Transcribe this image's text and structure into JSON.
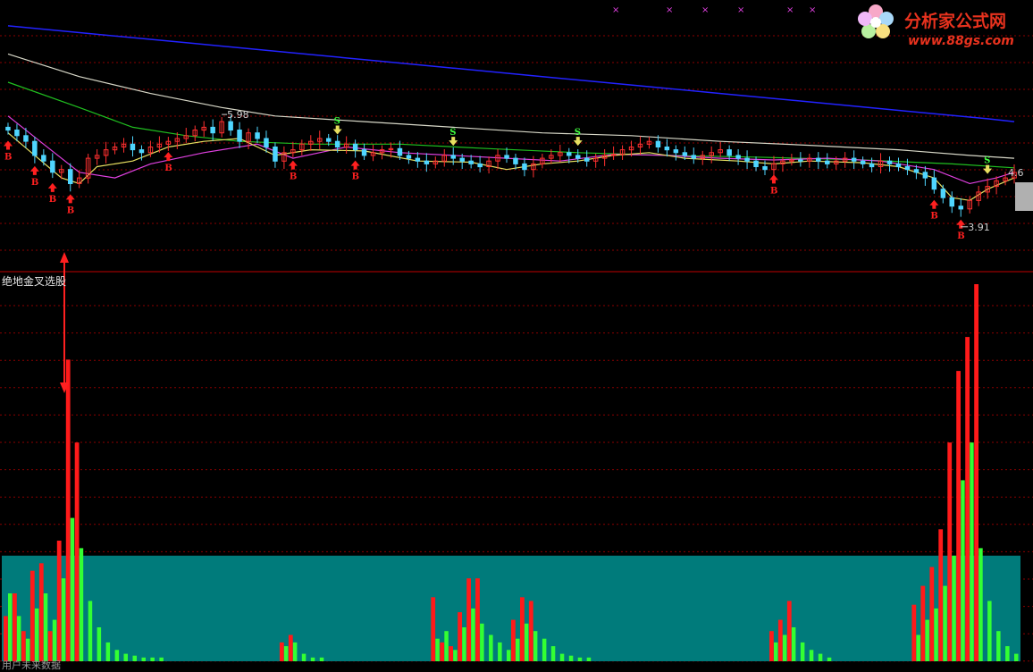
{
  "logo": {
    "name": "分析家公式网",
    "url": "www.88gs.com",
    "colors": {
      "name": "#e8321e",
      "url": "#e8321e"
    }
  },
  "colors": {
    "background": "#000000",
    "divider": "#c00000",
    "grid": "#8b0000",
    "up_candle": "#ff3030",
    "down_candle": "#4fd6ff",
    "bar_red": "#ff1a1a",
    "bar_green": "#33ff33",
    "teal_area": "#007b7b",
    "ma_blue": "#2222ff",
    "ma_white": "#d8d8c8",
    "ma_green": "#20c020",
    "ma_magenta": "#e040e0",
    "ma_yellow": "#e8e060",
    "signal_b": "#ff2020",
    "signal_s": "#40ff40"
  },
  "indicator": {
    "title": "绝地金叉选股",
    "bottom_label": "用户未来数据"
  },
  "chart_data": [
    {
      "type": "line",
      "name": "price-panel",
      "annotations": {
        "high": "5.98",
        "low": "3.91",
        "last": "4.6"
      },
      "x_count": 114,
      "series": [
        {
          "color": "#2222ff",
          "values": [
            [
              0,
              7.9
            ],
            [
              10,
              7.75
            ],
            [
              20,
              7.6
            ],
            [
              30,
              7.45
            ],
            [
              40,
              7.3
            ],
            [
              50,
              7.15
            ],
            [
              60,
              7.0
            ],
            [
              70,
              6.85
            ],
            [
              80,
              6.7
            ],
            [
              90,
              6.55
            ],
            [
              100,
              6.4
            ],
            [
              110,
              6.25
            ],
            [
              113,
              6.2
            ]
          ]
        },
        {
          "color": "#d8d8c8",
          "values": [
            [
              0,
              7.4
            ],
            [
              8,
              7.0
            ],
            [
              16,
              6.7
            ],
            [
              24,
              6.45
            ],
            [
              30,
              6.3
            ],
            [
              40,
              6.2
            ],
            [
              50,
              6.1
            ],
            [
              60,
              6.0
            ],
            [
              70,
              5.95
            ],
            [
              80,
              5.85
            ],
            [
              90,
              5.78
            ],
            [
              100,
              5.7
            ],
            [
              108,
              5.6
            ],
            [
              113,
              5.55
            ]
          ]
        },
        {
          "color": "#20c020",
          "values": [
            [
              0,
              6.9
            ],
            [
              8,
              6.45
            ],
            [
              14,
              6.1
            ],
            [
              20,
              5.95
            ],
            [
              26,
              5.85
            ],
            [
              34,
              5.8
            ],
            [
              44,
              5.8
            ],
            [
              54,
              5.72
            ],
            [
              64,
              5.65
            ],
            [
              74,
              5.6
            ],
            [
              84,
              5.57
            ],
            [
              96,
              5.52
            ],
            [
              106,
              5.45
            ],
            [
              113,
              5.38
            ]
          ]
        },
        {
          "color": "#e040e0",
          "values": [
            [
              0,
              6.3
            ],
            [
              4,
              5.8
            ],
            [
              8,
              5.3
            ],
            [
              12,
              5.2
            ],
            [
              16,
              5.45
            ],
            [
              22,
              5.65
            ],
            [
              28,
              5.8
            ],
            [
              32,
              5.55
            ],
            [
              38,
              5.75
            ],
            [
              44,
              5.65
            ],
            [
              50,
              5.6
            ],
            [
              56,
              5.55
            ],
            [
              62,
              5.5
            ],
            [
              68,
              5.62
            ],
            [
              74,
              5.6
            ],
            [
              80,
              5.55
            ],
            [
              86,
              5.52
            ],
            [
              92,
              5.55
            ],
            [
              98,
              5.5
            ],
            [
              104,
              5.35
            ],
            [
              108,
              5.1
            ],
            [
              111,
              5.2
            ],
            [
              113,
              5.3
            ]
          ]
        },
        {
          "color": "#e8e060",
          "values": [
            [
              0,
              6.0
            ],
            [
              3,
              5.6
            ],
            [
              6,
              5.2
            ],
            [
              8,
              5.1
            ],
            [
              10,
              5.4
            ],
            [
              14,
              5.5
            ],
            [
              18,
              5.75
            ],
            [
              22,
              5.85
            ],
            [
              26,
              5.9
            ],
            [
              30,
              5.6
            ],
            [
              34,
              5.7
            ],
            [
              40,
              5.68
            ],
            [
              46,
              5.5
            ],
            [
              52,
              5.48
            ],
            [
              56,
              5.35
            ],
            [
              60,
              5.45
            ],
            [
              64,
              5.5
            ],
            [
              68,
              5.6
            ],
            [
              72,
              5.65
            ],
            [
              76,
              5.55
            ],
            [
              82,
              5.5
            ],
            [
              86,
              5.45
            ],
            [
              90,
              5.5
            ],
            [
              96,
              5.47
            ],
            [
              100,
              5.4
            ],
            [
              104,
              5.2
            ],
            [
              106,
              4.85
            ],
            [
              108,
              4.8
            ],
            [
              110,
              5.0
            ],
            [
              113,
              5.2
            ]
          ]
        }
      ],
      "closes": [
        6.05,
        5.95,
        5.85,
        5.6,
        5.5,
        5.3,
        5.35,
        5.1,
        5.2,
        5.55,
        5.6,
        5.7,
        5.75,
        5.8,
        5.7,
        5.65,
        5.75,
        5.8,
        5.85,
        5.9,
        5.95,
        6.05,
        6.1,
        6.0,
        6.2,
        6.05,
        5.85,
        6.0,
        5.9,
        5.75,
        5.5,
        5.65,
        5.7,
        5.8,
        5.85,
        5.9,
        5.85,
        5.75,
        5.8,
        5.7,
        5.6,
        5.65,
        5.7,
        5.72,
        5.6,
        5.55,
        5.5,
        5.45,
        5.5,
        5.6,
        5.55,
        5.5,
        5.45,
        5.4,
        5.5,
        5.6,
        5.55,
        5.45,
        5.35,
        5.45,
        5.55,
        5.6,
        5.65,
        5.6,
        5.55,
        5.5,
        5.55,
        5.6,
        5.62,
        5.7,
        5.75,
        5.8,
        5.85,
        5.75,
        5.7,
        5.65,
        5.6,
        5.55,
        5.6,
        5.65,
        5.7,
        5.6,
        5.55,
        5.5,
        5.4,
        5.35,
        5.45,
        5.5,
        5.52,
        5.5,
        5.55,
        5.5,
        5.45,
        5.5,
        5.55,
        5.5,
        5.45,
        5.4,
        5.5,
        5.45,
        5.4,
        5.35,
        5.3,
        5.2,
        5.0,
        4.85,
        4.7,
        4.65,
        4.8,
        4.95,
        5.05,
        5.15,
        5.2,
        5.3
      ],
      "signals": [
        {
          "i": 0,
          "type": "B",
          "at": "below"
        },
        {
          "i": 3,
          "type": "B",
          "at": "below"
        },
        {
          "i": 5,
          "type": "B",
          "at": "below"
        },
        {
          "i": 7,
          "type": "B",
          "at": "below"
        },
        {
          "i": 18,
          "type": "B",
          "at": "below"
        },
        {
          "i": 32,
          "type": "B",
          "at": "below"
        },
        {
          "i": 37,
          "type": "S",
          "at": "above"
        },
        {
          "i": 39,
          "type": "B",
          "at": "below"
        },
        {
          "i": 50,
          "type": "S",
          "at": "above"
        },
        {
          "i": 64,
          "type": "S",
          "at": "above"
        },
        {
          "i": 86,
          "type": "B",
          "at": "below"
        },
        {
          "i": 104,
          "type": "B",
          "at": "below"
        },
        {
          "i": 107,
          "type": "B",
          "at": "below"
        },
        {
          "i": 110,
          "type": "S",
          "at": "above"
        }
      ]
    },
    {
      "type": "bar",
      "name": "indicator-panel",
      "title": "绝地金叉选股",
      "teal_level": 0.28,
      "n": 114,
      "bars": [
        {
          "i": 0,
          "r": 0.12,
          "g": 0.18
        },
        {
          "i": 1,
          "r": 0.18,
          "g": 0.12
        },
        {
          "i": 2,
          "r": 0.08,
          "g": 0.06
        },
        {
          "i": 3,
          "r": 0.24,
          "g": 0.14
        },
        {
          "i": 4,
          "r": 0.26,
          "g": 0.18
        },
        {
          "i": 5,
          "r": 0.08,
          "g": 0.11
        },
        {
          "i": 6,
          "r": 0.32,
          "g": 0.22
        },
        {
          "i": 7,
          "r": 0.8,
          "g": 0.38
        },
        {
          "i": 8,
          "r": 0.58,
          "g": 0.3
        },
        {
          "i": 9,
          "r": 0,
          "g": 0.16
        },
        {
          "i": 10,
          "r": 0,
          "g": 0.09
        },
        {
          "i": 11,
          "r": 0,
          "g": 0.05
        },
        {
          "i": 12,
          "r": 0,
          "g": 0.03
        },
        {
          "i": 13,
          "r": 0,
          "g": 0.02
        },
        {
          "i": 14,
          "r": 0,
          "g": 0.015
        },
        {
          "i": 15,
          "r": 0,
          "g": 0.01
        },
        {
          "i": 16,
          "r": 0,
          "g": 0.01
        },
        {
          "i": 17,
          "r": 0,
          "g": 0.01
        },
        {
          "i": 31,
          "r": 0.05,
          "g": 0.04
        },
        {
          "i": 32,
          "r": 0.07,
          "g": 0.05
        },
        {
          "i": 33,
          "r": 0,
          "g": 0.02
        },
        {
          "i": 34,
          "r": 0,
          "g": 0.01
        },
        {
          "i": 35,
          "r": 0,
          "g": 0.01
        },
        {
          "i": 48,
          "r": 0.17,
          "g": 0.06
        },
        {
          "i": 49,
          "r": 0.05,
          "g": 0.08
        },
        {
          "i": 50,
          "r": 0.04,
          "g": 0.03
        },
        {
          "i": 51,
          "r": 0.13,
          "g": 0.09
        },
        {
          "i": 52,
          "r": 0.22,
          "g": 0.14
        },
        {
          "i": 53,
          "r": 0.22,
          "g": 0.1
        },
        {
          "i": 54,
          "r": 0,
          "g": 0.07
        },
        {
          "i": 55,
          "r": 0,
          "g": 0.05
        },
        {
          "i": 56,
          "r": 0,
          "g": 0.03
        },
        {
          "i": 57,
          "r": 0.11,
          "g": 0.06
        },
        {
          "i": 58,
          "r": 0.17,
          "g": 0.1
        },
        {
          "i": 59,
          "r": 0.16,
          "g": 0.08
        },
        {
          "i": 60,
          "r": 0,
          "g": 0.06
        },
        {
          "i": 61,
          "r": 0,
          "g": 0.04
        },
        {
          "i": 62,
          "r": 0,
          "g": 0.02
        },
        {
          "i": 63,
          "r": 0,
          "g": 0.015
        },
        {
          "i": 64,
          "r": 0,
          "g": 0.01
        },
        {
          "i": 65,
          "r": 0,
          "g": 0.01
        },
        {
          "i": 86,
          "r": 0.08,
          "g": 0.05
        },
        {
          "i": 87,
          "r": 0.11,
          "g": 0.07
        },
        {
          "i": 88,
          "r": 0.16,
          "g": 0.09
        },
        {
          "i": 89,
          "r": 0,
          "g": 0.05
        },
        {
          "i": 90,
          "r": 0,
          "g": 0.03
        },
        {
          "i": 91,
          "r": 0,
          "g": 0.02
        },
        {
          "i": 92,
          "r": 0,
          "g": 0.01
        },
        {
          "i": 102,
          "r": 0.15,
          "g": 0.07
        },
        {
          "i": 103,
          "r": 0.2,
          "g": 0.11
        },
        {
          "i": 104,
          "r": 0.25,
          "g": 0.14
        },
        {
          "i": 105,
          "r": 0.35,
          "g": 0.2
        },
        {
          "i": 106,
          "r": 0.58,
          "g": 0.28
        },
        {
          "i": 107,
          "r": 0.77,
          "g": 0.48
        },
        {
          "i": 108,
          "r": 0.86,
          "g": 0.58
        },
        {
          "i": 109,
          "r": 1.0,
          "g": 0.3
        },
        {
          "i": 110,
          "r": 0,
          "g": 0.16
        },
        {
          "i": 111,
          "r": 0,
          "g": 0.08
        },
        {
          "i": 112,
          "r": 0,
          "g": 0.04
        },
        {
          "i": 113,
          "r": 0,
          "g": 0.02
        }
      ]
    }
  ]
}
